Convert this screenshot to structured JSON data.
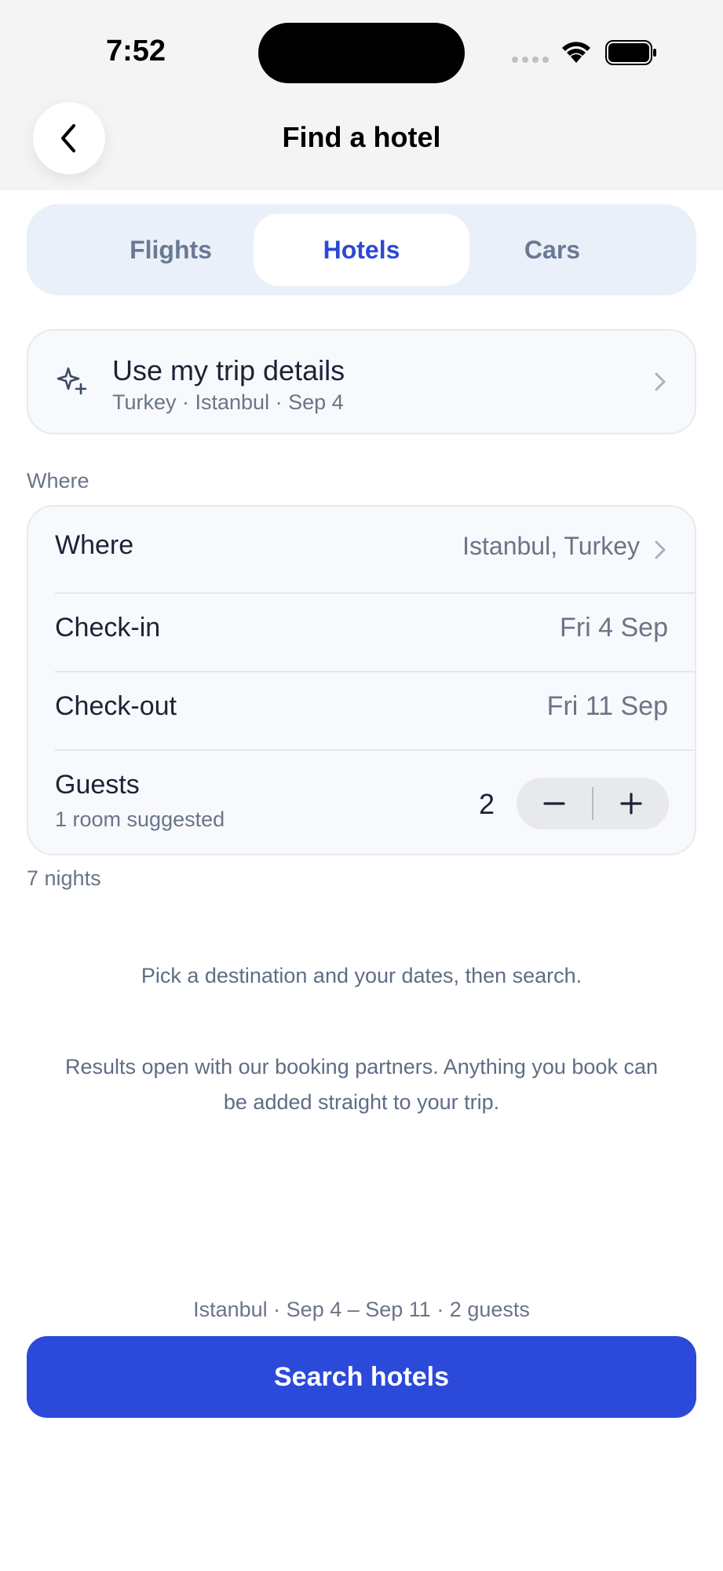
{
  "status": {
    "time": "7:52"
  },
  "nav": {
    "title": "Find a hotel"
  },
  "tabs": [
    {
      "label": "Flights"
    },
    {
      "label": "Hotels",
      "active": true
    },
    {
      "label": "Cars"
    }
  ],
  "trip": {
    "title": "Use my trip details",
    "subtitle": "Turkey · Istanbul · Sep 4"
  },
  "form": {
    "section_label": "Where",
    "where": {
      "label": "Where",
      "value": "Istanbul, Turkey"
    },
    "checkin": {
      "label": "Check-in",
      "value": "Fri 4 Sep"
    },
    "checkout": {
      "label": "Check-out",
      "value": "Fri 11 Sep"
    },
    "guests": {
      "label": "Guests",
      "sub": "1 room suggested",
      "count": "2"
    }
  },
  "nights": "7 nights",
  "hint1": "Pick a destination and your dates, then search.",
  "hint2_line1": "Results open with our booking partners. Anything you book can",
  "hint2_line2": "be added straight to your trip.",
  "summary": "Istanbul · Sep 4 – Sep 11 · 2 guests",
  "search_button": "Search hotels",
  "colors": {
    "accent": "#2c4ad9",
    "segment_bg": "#e9f0f9",
    "card_bg": "#f7f9fc"
  },
  "icons": [
    "back-chevron-icon",
    "sparkle-icon",
    "chevron-right-icon",
    "minus-icon",
    "plus-icon",
    "wifi-icon",
    "battery-icon"
  ]
}
